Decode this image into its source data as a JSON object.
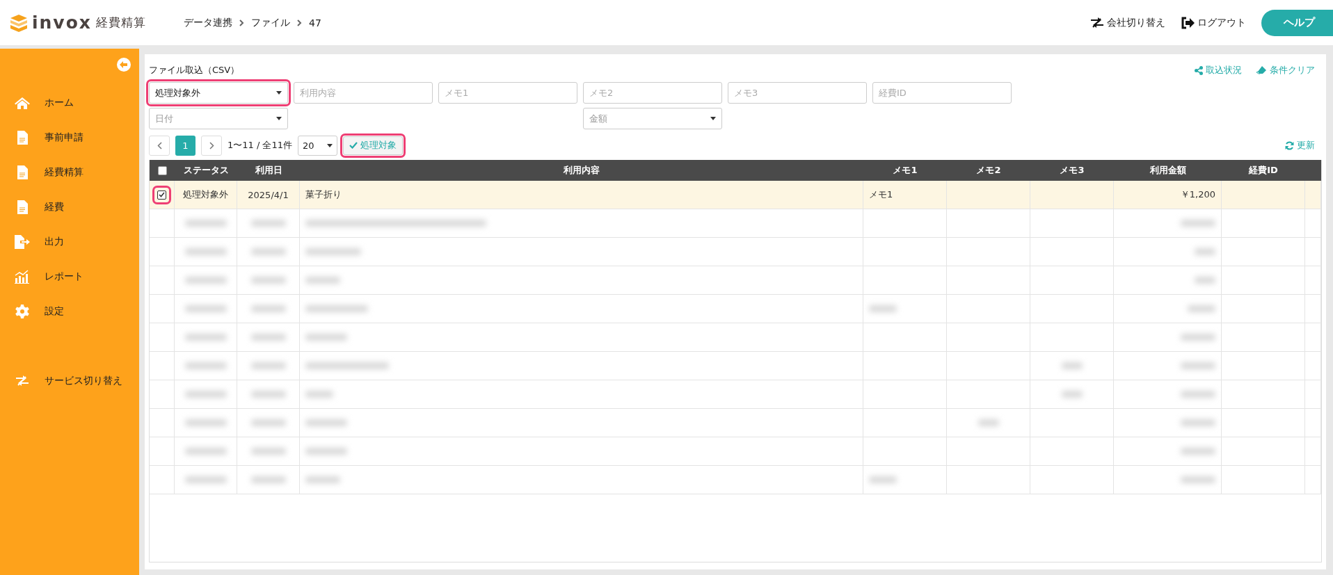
{
  "header": {
    "logo_text": "invox",
    "logo_subtitle": "経費精算",
    "breadcrumbs": [
      "データ連携",
      "ファイル",
      "47"
    ],
    "actions": [
      {
        "label": "会社切り替え",
        "kind": "switch"
      },
      {
        "label": "ログアウト",
        "kind": "logout"
      }
    ],
    "help_button": "ヘルプ"
  },
  "sidebar": {
    "items": [
      {
        "label": "ホーム",
        "kind": "home"
      },
      {
        "label": "事前申請",
        "kind": "doc"
      },
      {
        "label": "経費精算",
        "kind": "doc"
      },
      {
        "label": "経費",
        "kind": "doc"
      },
      {
        "label": "出力",
        "kind": "export"
      },
      {
        "label": "レポート",
        "kind": "report"
      },
      {
        "label": "設定",
        "kind": "gear"
      }
    ],
    "footer_item": {
      "label": "サービス切り替え",
      "kind": "switch"
    }
  },
  "panel": {
    "title": "ファイル取込（CSV）",
    "links": [
      {
        "label": "取込状況",
        "kind": "share"
      },
      {
        "label": "条件クリア",
        "kind": "eraser"
      }
    ],
    "filter_rows": [
      [
        {
          "kind": "select",
          "value": "処理対象外",
          "highlighted": true
        },
        {
          "kind": "text",
          "placeholder": "利用内容"
        },
        {
          "kind": "text",
          "placeholder": "メモ1"
        },
        {
          "kind": "text",
          "placeholder": "メモ2"
        },
        {
          "kind": "text",
          "placeholder": "メモ3"
        },
        {
          "kind": "text",
          "placeholder": "経費ID"
        }
      ],
      [
        {
          "kind": "select",
          "placeholder": "日付",
          "highlighted": false
        },
        {
          "kind": "select",
          "placeholder": "金額",
          "highlighted": false
        }
      ]
    ],
    "pagination": {
      "pages": [
        {
          "label": "1",
          "selected": true
        }
      ],
      "range": "1〜11 / 全11件",
      "page_size": "20"
    },
    "process_button": {
      "label": "処理対象",
      "highlighted": true
    },
    "refresh": "更新",
    "table": {
      "select_all_checked": false,
      "columns": [
        "ステータス",
        "利用日",
        "利用内容",
        "メモ1",
        "メモ2",
        "メモ3",
        "利用金額",
        "経費ID"
      ],
      "rows": [
        {
          "checked": true,
          "highlighted": true,
          "cells": {
            "status": "処理対象外",
            "date": "2025/4/1",
            "content": "菓子折り",
            "memo1": "メモ1",
            "amount": "￥1,200"
          }
        }
      ],
      "blurred_rows": [
        {
          "kind": "blurred"
        },
        {
          "kind": "blurred"
        },
        {
          "kind": "blurred"
        },
        {
          "kind": "blurred"
        },
        {
          "kind": "blurred"
        },
        {
          "kind": "blurred"
        },
        {
          "kind": "blurred"
        },
        {
          "kind": "blurred"
        },
        {
          "kind": "blurred"
        },
        {
          "kind": "blurred"
        }
      ]
    }
  }
}
